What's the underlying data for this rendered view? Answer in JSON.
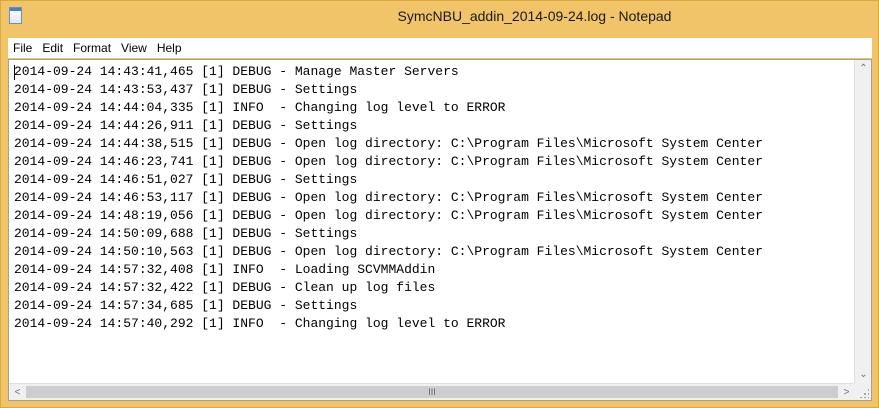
{
  "window": {
    "title": "SymcNBU_addin_2014-09-24.log - Notepad",
    "icon": "notepad-icon"
  },
  "menu": [
    "File",
    "Edit",
    "Format",
    "View",
    "Help"
  ],
  "lines": [
    "2014-09-24 14:43:41,465 [1] DEBUG - Manage Master Servers",
    "2014-09-24 14:43:53,437 [1] DEBUG - Settings",
    "2014-09-24 14:44:04,335 [1] INFO  - Changing log level to ERROR",
    "2014-09-24 14:44:26,911 [1] DEBUG - Settings",
    "2014-09-24 14:44:38,515 [1] DEBUG - Open log directory: C:\\Program Files\\Microsoft System Center",
    "2014-09-24 14:46:23,741 [1] DEBUG - Open log directory: C:\\Program Files\\Microsoft System Center",
    "2014-09-24 14:46:51,027 [1] DEBUG - Settings",
    "2014-09-24 14:46:53,117 [1] DEBUG - Open log directory: C:\\Program Files\\Microsoft System Center",
    "2014-09-24 14:48:19,056 [1] DEBUG - Open log directory: C:\\Program Files\\Microsoft System Center",
    "2014-09-24 14:50:09,688 [1] DEBUG - Settings",
    "2014-09-24 14:50:10,563 [1] DEBUG - Open log directory: C:\\Program Files\\Microsoft System Center",
    "2014-09-24 14:57:32,408 [1] INFO  - Loading SCVMMAddin",
    "2014-09-24 14:57:32,422 [1] DEBUG - Clean up log files",
    "2014-09-24 14:57:34,685 [1] DEBUG - Settings",
    "2014-09-24 14:57:40,292 [1] INFO  - Changing log level to ERROR"
  ],
  "scrollbar": {
    "up_glyph": "⌃",
    "down_glyph": "⌄",
    "left_glyph": "<",
    "right_glyph": ">",
    "grip_glyph": "III"
  },
  "colors": {
    "frame": "#f2c46a",
    "text": "#000000"
  }
}
